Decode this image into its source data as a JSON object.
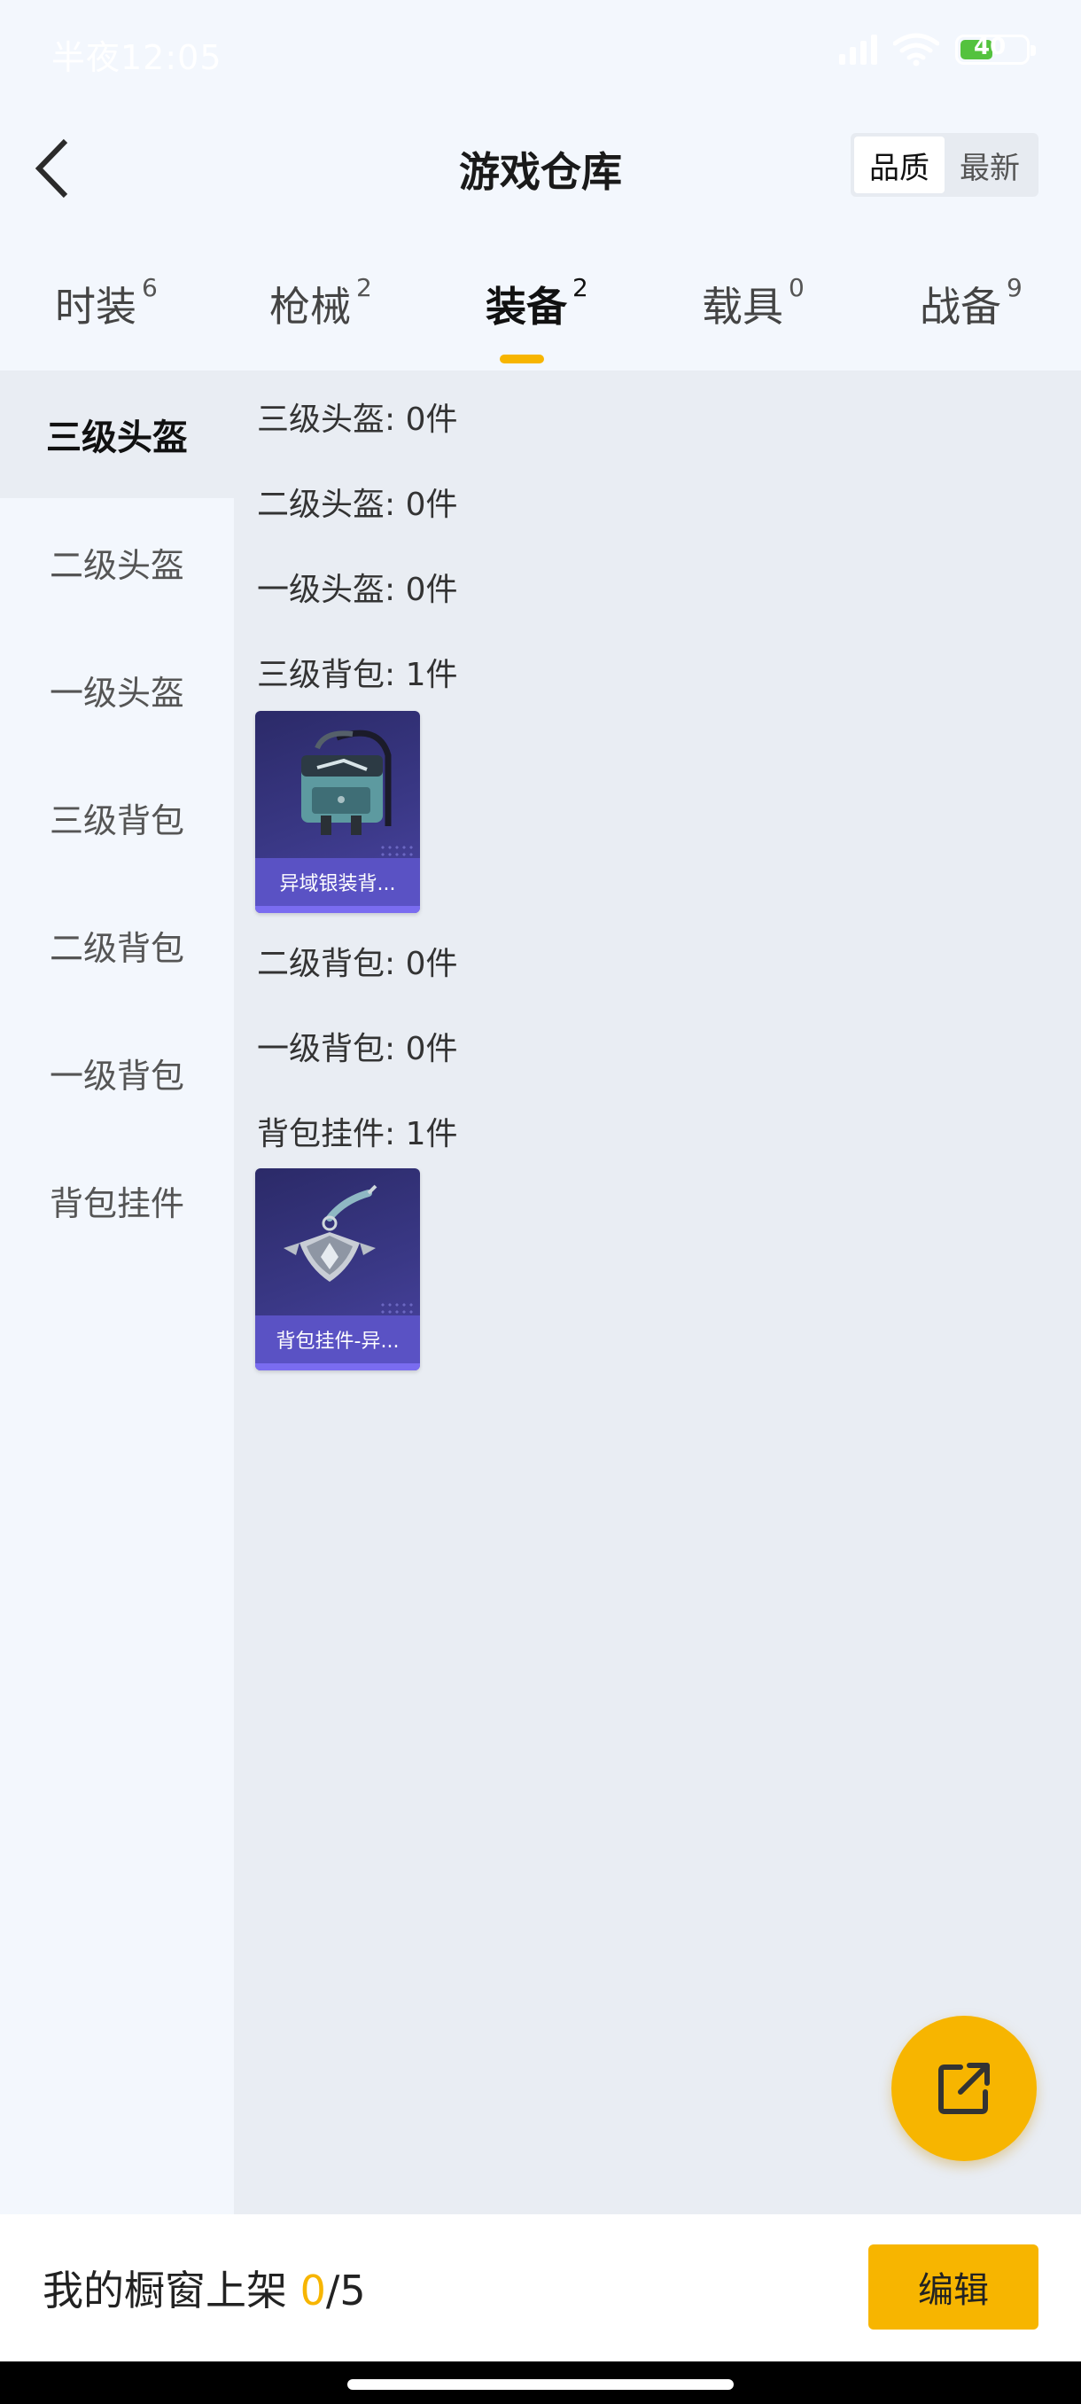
{
  "status_bar": {
    "time": "半夜12:05",
    "battery_level": "40"
  },
  "header": {
    "title": "游戏仓库",
    "sort_options": [
      "品质",
      "最新"
    ],
    "sort_selected": "品质"
  },
  "tabs": [
    {
      "label": "时装",
      "count": "6",
      "active": false
    },
    {
      "label": "枪械",
      "count": "2",
      "active": false
    },
    {
      "label": "装备",
      "count": "2",
      "active": true
    },
    {
      "label": "载具",
      "count": "0",
      "active": false
    },
    {
      "label": "战备",
      "count": "9",
      "active": false
    }
  ],
  "sidebar": {
    "items": [
      "三级头盔",
      "二级头盔",
      "一级头盔",
      "三级背包",
      "二级背包",
      "一级背包",
      "背包挂件"
    ],
    "selected": "三级头盔"
  },
  "content": {
    "groups": [
      {
        "title": "三级头盔: 0件"
      },
      {
        "title": "二级头盔: 0件"
      },
      {
        "title": "一级头盔: 0件"
      },
      {
        "title": "三级背包: 1件",
        "items": [
          {
            "name": "异域银装背...",
            "icon": "backpack-icon"
          }
        ]
      },
      {
        "title": "二级背包: 0件"
      },
      {
        "title": "一级背包: 0件"
      },
      {
        "title": "背包挂件: 1件",
        "items": [
          {
            "name": "背包挂件-异...",
            "icon": "pendant-icon"
          }
        ]
      }
    ]
  },
  "fab": {
    "icon": "share-external-icon"
  },
  "bottom_bar": {
    "label": "我的橱窗上架 ",
    "current": "0",
    "total": "/5",
    "edit_label": "编辑"
  },
  "colors": {
    "accent": "#f7b500",
    "card_bg": "#3a3886",
    "card_label": "#5a52c4"
  }
}
